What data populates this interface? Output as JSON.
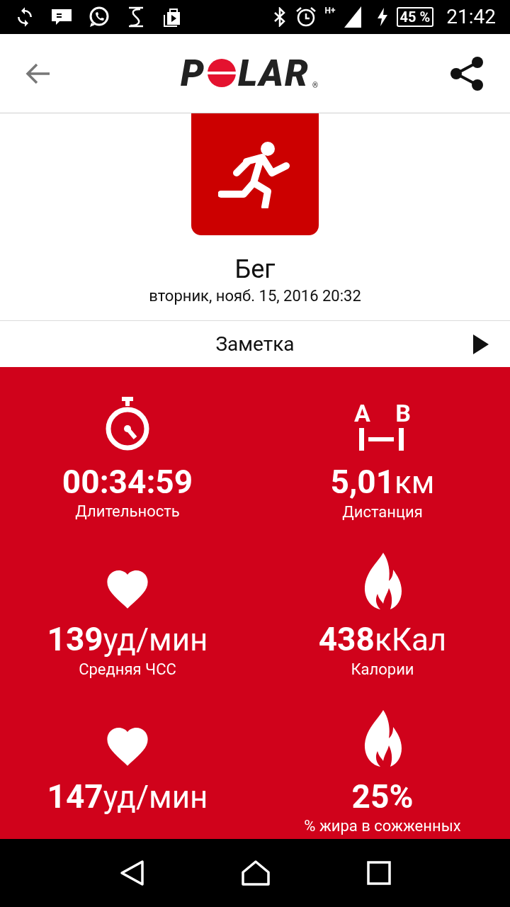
{
  "status_bar": {
    "network": "H+",
    "battery": "45 %",
    "time": "21:42"
  },
  "header": {
    "logo": {
      "before": "P",
      "after": "LAR",
      "mark": "®"
    }
  },
  "activity": {
    "title": "Бег",
    "date": "вторник, нояб. 15, 2016 20:32"
  },
  "note": {
    "label": "Заметка"
  },
  "distance_icon": {
    "letters": [
      "A",
      "B"
    ]
  },
  "stats": [
    {
      "kind": "timer",
      "value": "00:34:59",
      "label": "Длительность"
    },
    {
      "kind": "distance",
      "value": "5,01",
      "unit": "км",
      "label": "Дистанция"
    },
    {
      "kind": "heart",
      "value": "139",
      "unit": "уд/мин",
      "label": "Средняя ЧСС"
    },
    {
      "kind": "flame",
      "value": "438",
      "unit": "кКал",
      "label": "Калории"
    },
    {
      "kind": "heart",
      "value": "147",
      "unit": "уд/мин"
    },
    {
      "kind": "flame",
      "value": "25%",
      "label": "% жира в сожженных"
    }
  ]
}
